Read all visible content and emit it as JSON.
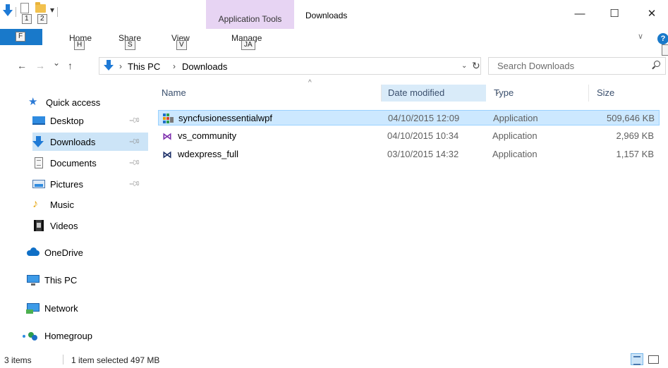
{
  "quick_access_toolbar": {
    "keytip_1": "1",
    "keytip_2": "2",
    "dropdown_glyph": "▾"
  },
  "contextual_tab": {
    "label": "Application Tools"
  },
  "window": {
    "title": "Downloads",
    "minimize_glyph": "—",
    "maximize_glyph": "☐",
    "close_glyph": "✕"
  },
  "ribbon": {
    "file_keytip": "F",
    "tabs": [
      {
        "label": "Home",
        "keytip": "H"
      },
      {
        "label": "Share",
        "keytip": "S"
      },
      {
        "label": "View",
        "keytip": "V"
      },
      {
        "label": "Manage",
        "keytip": "JA"
      }
    ],
    "collapse_glyph": "∨",
    "help_glyph": "?"
  },
  "navigation": {
    "back_glyph": "←",
    "forward_glyph": "→",
    "recent_glyph": "⌄",
    "up_glyph": "↑",
    "breadcrumb": [
      "This PC",
      "Downloads"
    ],
    "breadcrumb_separator": "›",
    "dropdown_glyph": "⌄",
    "refresh_glyph": "↻"
  },
  "search": {
    "placeholder": "Search Downloads",
    "icon": "search-icon"
  },
  "sidebar": {
    "quick_access": "Quick access",
    "pinned": [
      {
        "label": "Desktop",
        "icon": "desktop-icon",
        "pinned": true
      },
      {
        "label": "Downloads",
        "icon": "downloads-icon",
        "pinned": true,
        "selected": true
      },
      {
        "label": "Documents",
        "icon": "documents-icon",
        "pinned": true
      },
      {
        "label": "Pictures",
        "icon": "pictures-icon",
        "pinned": true
      },
      {
        "label": "Music",
        "icon": "music-icon",
        "pinned": false
      },
      {
        "label": "Videos",
        "icon": "videos-icon",
        "pinned": false
      }
    ],
    "locations": [
      {
        "label": "OneDrive",
        "icon": "onedrive-icon"
      },
      {
        "label": "This PC",
        "icon": "this-pc-icon"
      },
      {
        "label": "Network",
        "icon": "network-icon"
      },
      {
        "label": "Homegroup",
        "icon": "homegroup-icon"
      }
    ]
  },
  "file_list": {
    "columns": {
      "name": "Name",
      "date_modified": "Date modified",
      "type": "Type",
      "size": "Size"
    },
    "sort_glyph": "^",
    "column_dropdown_glyph": "⌄",
    "rows": [
      {
        "name": "syncfusionessentialwpf",
        "date": "04/10/2015 12:09",
        "type": "Application",
        "size": "509,646 KB",
        "selected": true,
        "icon": "syncfusion-icon"
      },
      {
        "name": "vs_community",
        "date": "04/10/2015 10:34",
        "type": "Application",
        "size": "2,969 KB",
        "selected": false,
        "icon": "visual-studio-icon"
      },
      {
        "name": "wdexpress_full",
        "date": "03/10/2015 14:32",
        "type": "Application",
        "size": "1,157 KB",
        "selected": false,
        "icon": "visual-studio-express-icon"
      }
    ]
  },
  "status_bar": {
    "item_count": "3 items",
    "selection": "1 item selected  497 MB"
  },
  "colors": {
    "accent": "#1979ca",
    "selection": "#cce8ff",
    "contextual_tab": "#e7d4f3"
  }
}
